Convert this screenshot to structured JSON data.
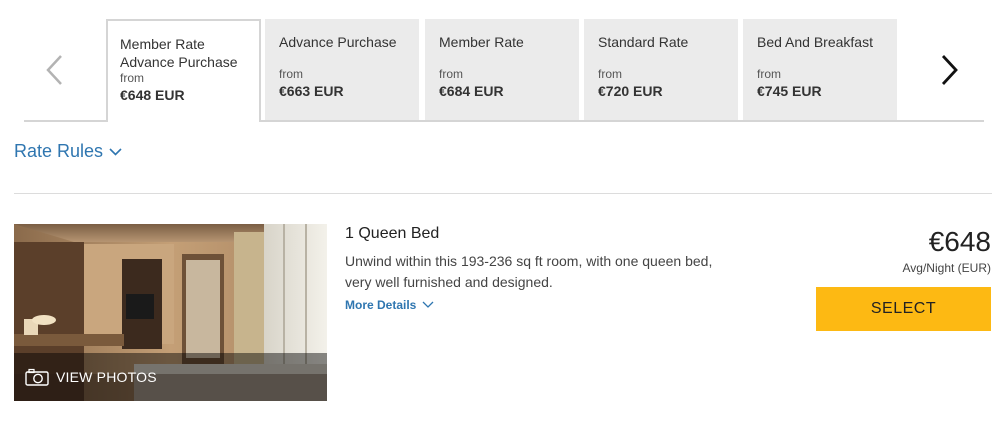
{
  "rate_tabs": [
    {
      "name": "Member Rate Advance Purchase",
      "from_label": "from",
      "price": "€648 EUR",
      "active": true
    },
    {
      "name": "Advance Purchase",
      "from_label": "from",
      "price": "€663 EUR",
      "active": false
    },
    {
      "name": "Member Rate",
      "from_label": "from",
      "price": "€684 EUR",
      "active": false
    },
    {
      "name": "Standard Rate",
      "from_label": "from",
      "price": "€720 EUR",
      "active": false
    },
    {
      "name": "Bed And Breakfast",
      "from_label": "from",
      "price": "€745 EUR",
      "active": false
    }
  ],
  "nav": {
    "prev_icon": "chevron-left-icon",
    "next_icon": "chevron-right-icon"
  },
  "rate_rules": {
    "label": "Rate Rules",
    "icon": "chevron-down-icon"
  },
  "room": {
    "photo_label": "VIEW PHOTOS",
    "photo_icon": "camera-icon",
    "title": "1 Queen Bed",
    "description": "Unwind within this 193-236 sq ft room, with one queen bed, very well furnished and designed.",
    "more_details": "More Details",
    "price": "€648",
    "price_note": "Avg/Night (EUR)",
    "select_label": "SELECT"
  },
  "colors": {
    "accent_blue": "#2f76b0",
    "select_yellow": "#fdb913",
    "tab_bg": "#ebebeb"
  }
}
